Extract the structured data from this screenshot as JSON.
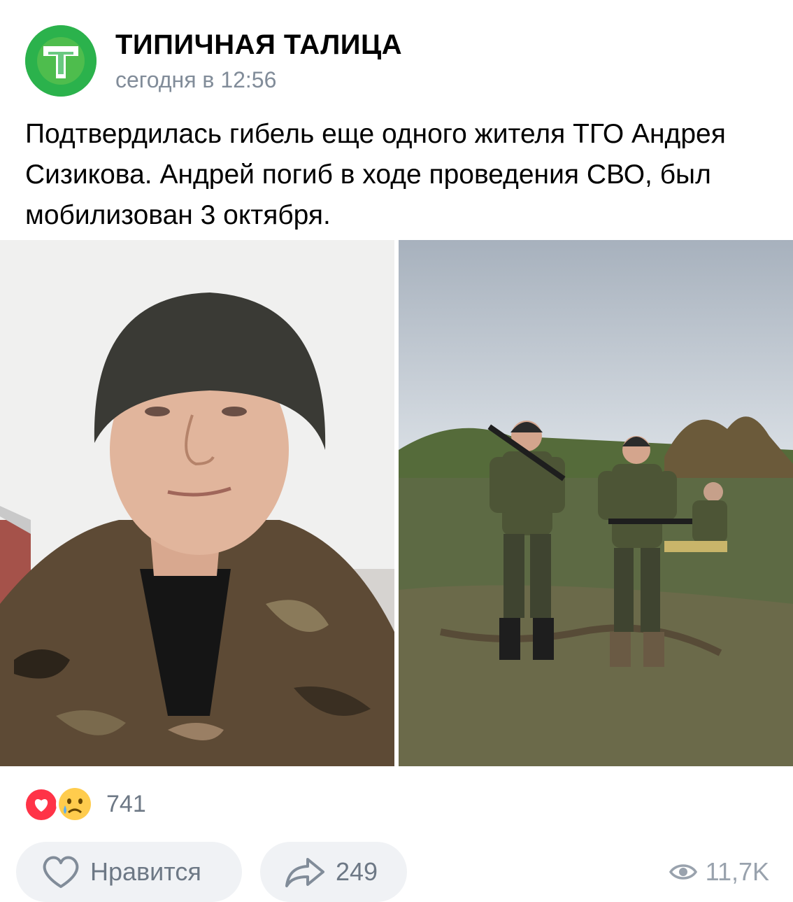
{
  "post": {
    "author": "ТИПИЧНАЯ ТАЛИЦА",
    "time": "сегодня в 12:56",
    "text": "Подтвердилась гибель еще одного жителя ТГО Андрея Сизикова. Андрей погиб в ходе проведения СВО, был мобилизован 3 октября."
  },
  "reactions": {
    "icons": [
      "heart-icon",
      "crying-face-icon"
    ],
    "count": "741"
  },
  "actions": {
    "like_label": "Нравится",
    "share_count": "249",
    "views": "11,7K"
  },
  "colors": {
    "brand_green": "#2bb24c",
    "heart_red": "#ff3347",
    "meta_gray": "#818c99",
    "button_bg": "#f0f2f5"
  }
}
